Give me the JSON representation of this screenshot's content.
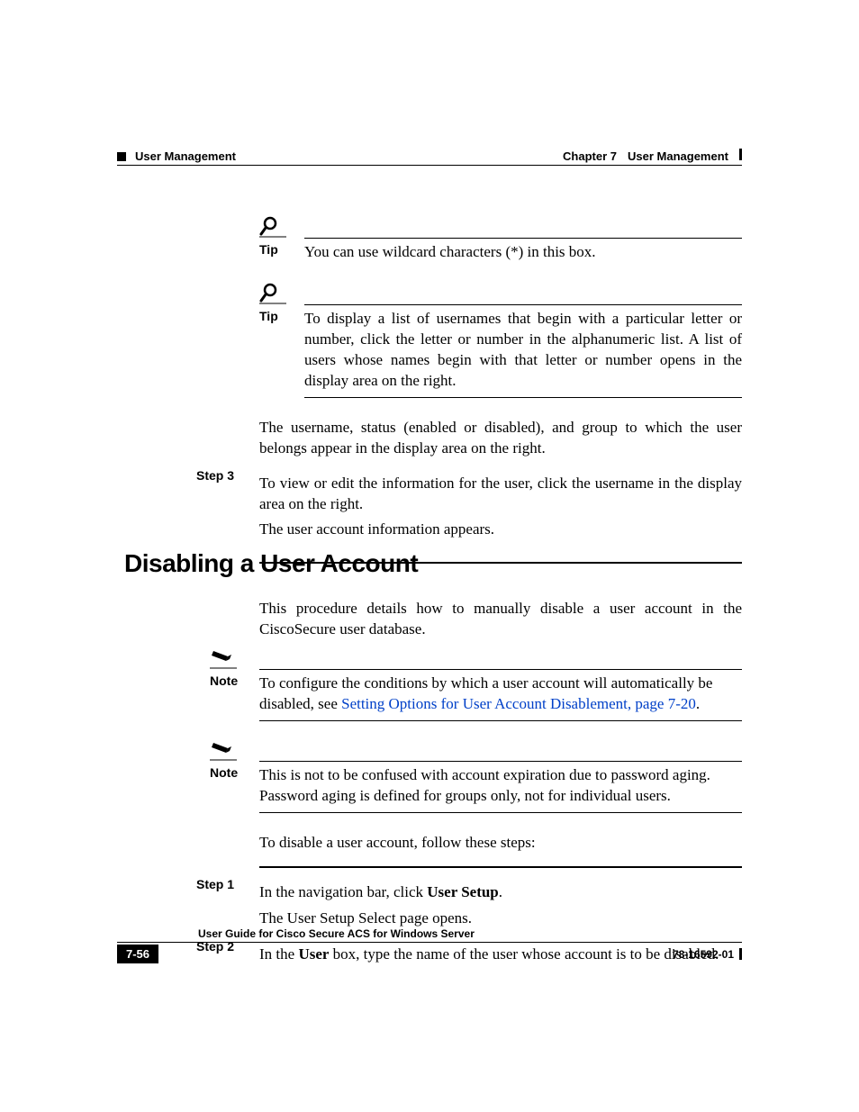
{
  "header": {
    "section": "User Management",
    "chapter_label": "Chapter 7",
    "chapter_title": "User Management"
  },
  "tip1": {
    "label": "Tip",
    "text": "You can use wildcard characters (*) in this box."
  },
  "tip2": {
    "label": "Tip",
    "text": "To display a list of usernames that begin with a particular letter or number, click the letter or number in the alphanumeric list. A list of users whose names begin with that letter or number opens in the display area on the right."
  },
  "para1": "The username, status (enabled or disabled), and group to which the user belongs appear in the display area on the right.",
  "step3": {
    "label": "Step 3",
    "line1": "To view or edit the information for the user, click the username in the display area on the right.",
    "line2": "The user account information appears."
  },
  "heading": "Disabling a User Account",
  "intro": "This procedure details how to manually disable a user account in the CiscoSecure user database.",
  "note1": {
    "label": "Note",
    "prefix": "To configure the conditions by which a user account will automatically be disabled, see ",
    "link": "Setting Options for User Account Disablement, page 7-20",
    "suffix": "."
  },
  "note2": {
    "label": "Note",
    "text": "This is not to be confused with account expiration due to password aging. Password aging is defined for groups only, not for individual users."
  },
  "lead": "To disable a user account, follow these steps:",
  "step1": {
    "label": "Step 1",
    "prefix": "In the navigation bar, click ",
    "bold": "User Setup",
    "suffix": ".",
    "line2": "The User Setup Select page opens."
  },
  "step2": {
    "label": "Step 2",
    "prefix": "In the ",
    "bold": "User",
    "suffix": " box, type the name of the user whose account is to be disabled."
  },
  "footer": {
    "title": "User Guide for Cisco Secure ACS for Windows Server",
    "page": "7-56",
    "docid": "78-16592-01"
  }
}
